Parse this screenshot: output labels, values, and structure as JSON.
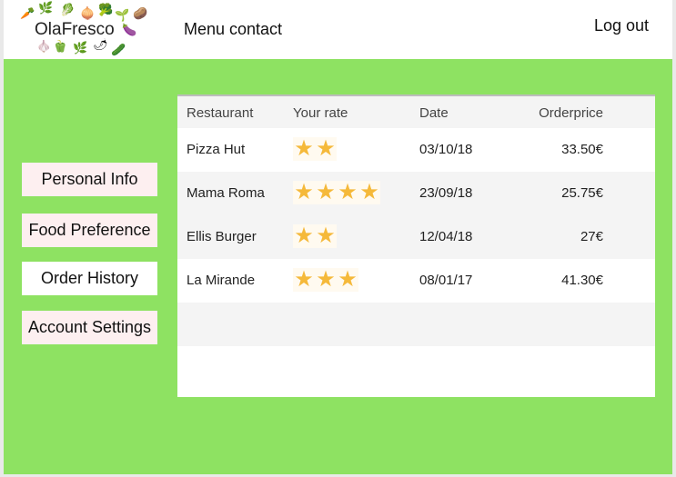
{
  "header": {
    "logo_text": "OlaFresco",
    "menu_contact": "Menu contact",
    "logout": "Log out"
  },
  "sidebar": {
    "items": [
      {
        "label": "Personal Info",
        "active": false
      },
      {
        "label": "Food Preference",
        "active": false
      },
      {
        "label": "Order History",
        "active": true
      },
      {
        "label": "Account Settings",
        "active": false
      }
    ]
  },
  "table": {
    "columns": [
      "Restaurant",
      "Your rate",
      "Date",
      "Orderprice"
    ],
    "rows": [
      {
        "restaurant": "Pizza Hut",
        "rating": 2,
        "date": "03/10/18",
        "price": "33.50€"
      },
      {
        "restaurant": "Mama Roma",
        "rating": 4,
        "date": "23/09/18",
        "price": "25.75€"
      },
      {
        "restaurant": "Ellis Burger",
        "rating": 2,
        "date": "12/04/18",
        "price": "27€"
      },
      {
        "restaurant": "La Mirande",
        "rating": 3,
        "date": "08/01/17",
        "price": "41.30€"
      }
    ]
  },
  "colors": {
    "main_background": "#8ee262",
    "button_background": "#fdeff0",
    "star": "#f5b93a"
  },
  "icons": [
    "vegetable-logo-icon",
    "star-icon"
  ]
}
